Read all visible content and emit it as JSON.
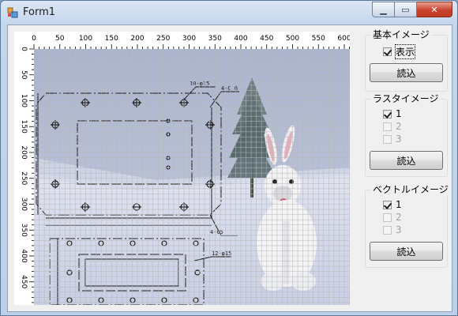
{
  "window": {
    "title": "Form1"
  },
  "ruler": {
    "x_ticks": [
      "0",
      "50",
      "100",
      "150",
      "200",
      "250",
      "300",
      "350",
      "400",
      "450",
      "500",
      "550",
      "600"
    ],
    "y_ticks": [
      "0",
      "50",
      "100",
      "150",
      "200",
      "250",
      "300",
      "350",
      "400",
      "450"
    ]
  },
  "panels": {
    "basic_image": {
      "title": "基本イメージ",
      "show_label": "表示",
      "show_checked": true,
      "load_label": "読込"
    },
    "raster_image": {
      "title": "ラスタイメージ",
      "items": [
        {
          "label": "1",
          "checked": true,
          "enabled": true
        },
        {
          "label": "2",
          "checked": false,
          "enabled": false
        },
        {
          "label": "3",
          "checked": false,
          "enabled": false
        }
      ],
      "load_label": "読込"
    },
    "vector_image": {
      "title": "ベクトルイメージ",
      "items": [
        {
          "label": "1",
          "checked": true,
          "enabled": true
        },
        {
          "label": "2",
          "checked": false,
          "enabled": false
        },
        {
          "label": "3",
          "checked": false,
          "enabled": false
        }
      ],
      "load_label": "読込"
    }
  },
  "drawing_annotations": [
    "10-φ15",
    "4-C 6",
    "4-C5",
    "12-φ15"
  ],
  "colors": {
    "sky": "#b9c3d9",
    "snow": "#e4e8f4",
    "grid": "#bcbcbc",
    "drawing": "#1a1a1a",
    "close_button": "#c9432e"
  }
}
